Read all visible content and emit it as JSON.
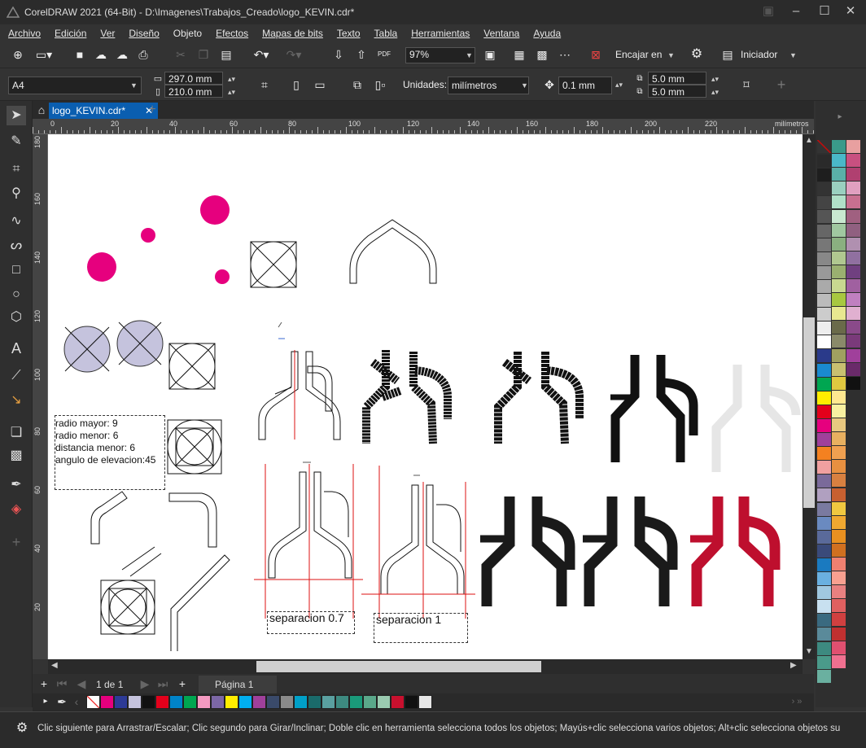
{
  "window": {
    "title": "CorelDRAW 2021 (64-Bit) - D:\\Imagenes\\Trabajos_Creado\\logo_KEVIN.cdr*"
  },
  "menu": [
    "Archivo",
    "Edición",
    "Ver",
    "Diseño",
    "Objeto",
    "Efectos",
    "Mapas de bits",
    "Texto",
    "Tabla",
    "Herramientas",
    "Ventana",
    "Ayuda"
  ],
  "toolbar": {
    "zoom": "97%",
    "snap_label": "Encajar en",
    "launcher_label": "Iniciador"
  },
  "propbar": {
    "page_size": "A4",
    "width": "297.0 mm",
    "height": "210.0 mm",
    "units_label": "Unidades:",
    "units_value": "milímetros",
    "nudge": "0.1 mm",
    "dup_x": "5.0 mm",
    "dup_y": "5.0 mm"
  },
  "tabs": {
    "document": "logo_KEVIN.cdr*"
  },
  "rulers": {
    "h_labels": [
      "0",
      "20",
      "40",
      "60",
      "80",
      "100",
      "120",
      "140",
      "160",
      "180",
      "200",
      "220"
    ],
    "h_unit": "milímetros",
    "v_labels": [
      "180",
      "160",
      "140",
      "120",
      "100",
      "80",
      "60",
      "40",
      "20"
    ],
    "v_unit": "milímetros"
  },
  "canvas": {
    "note1": [
      "radio mayor: 9",
      "radio menor: 6",
      "distancia menor: 6",
      "angulo de elevacion:45"
    ],
    "note2": "separacion 0.7",
    "note3": "separacion 1"
  },
  "pages": {
    "count": "1 de 1",
    "current": "Página 1"
  },
  "status": {
    "text": "Clic siguiente para Arrastrar/Escalar; Clic segundo para Girar/Inclinar; Doble clic en herramienta selecciona todos los objetos; Mayús+clic selecciona varios objetos; Alt+clic selecciona objetos su"
  },
  "colors": {
    "magenta": "#e6007e",
    "lavender": "#c5c3dd",
    "red": "#be0f2e",
    "grey": "#e6e6e6",
    "accent": "#0a5eb0"
  }
}
